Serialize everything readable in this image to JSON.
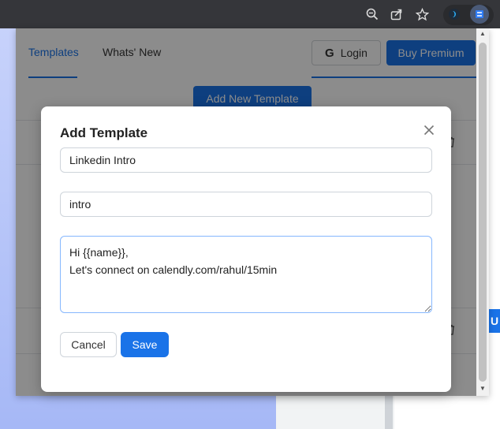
{
  "browser": {
    "toolbar_icons": [
      "zoom-icon",
      "share-icon",
      "star-icon",
      "extension-icon",
      "templates-extension-icon"
    ]
  },
  "popup": {
    "tabs": [
      {
        "label": "Templates",
        "active": true
      },
      {
        "label": "Whats' New",
        "active": false
      }
    ],
    "login_label": "Login",
    "premium_label": "Buy Premium",
    "add_new_label": "Add New Template",
    "colors": {
      "accent": "#1a73e8"
    }
  },
  "modal": {
    "title": "Add Template",
    "name_value": "Linkedin Intro",
    "shortcut_value": "intro",
    "body_value": "Hi {{name}},\nLet's connect on calendly.com/rahul/15min",
    "cancel_label": "Cancel",
    "save_label": "Save"
  }
}
